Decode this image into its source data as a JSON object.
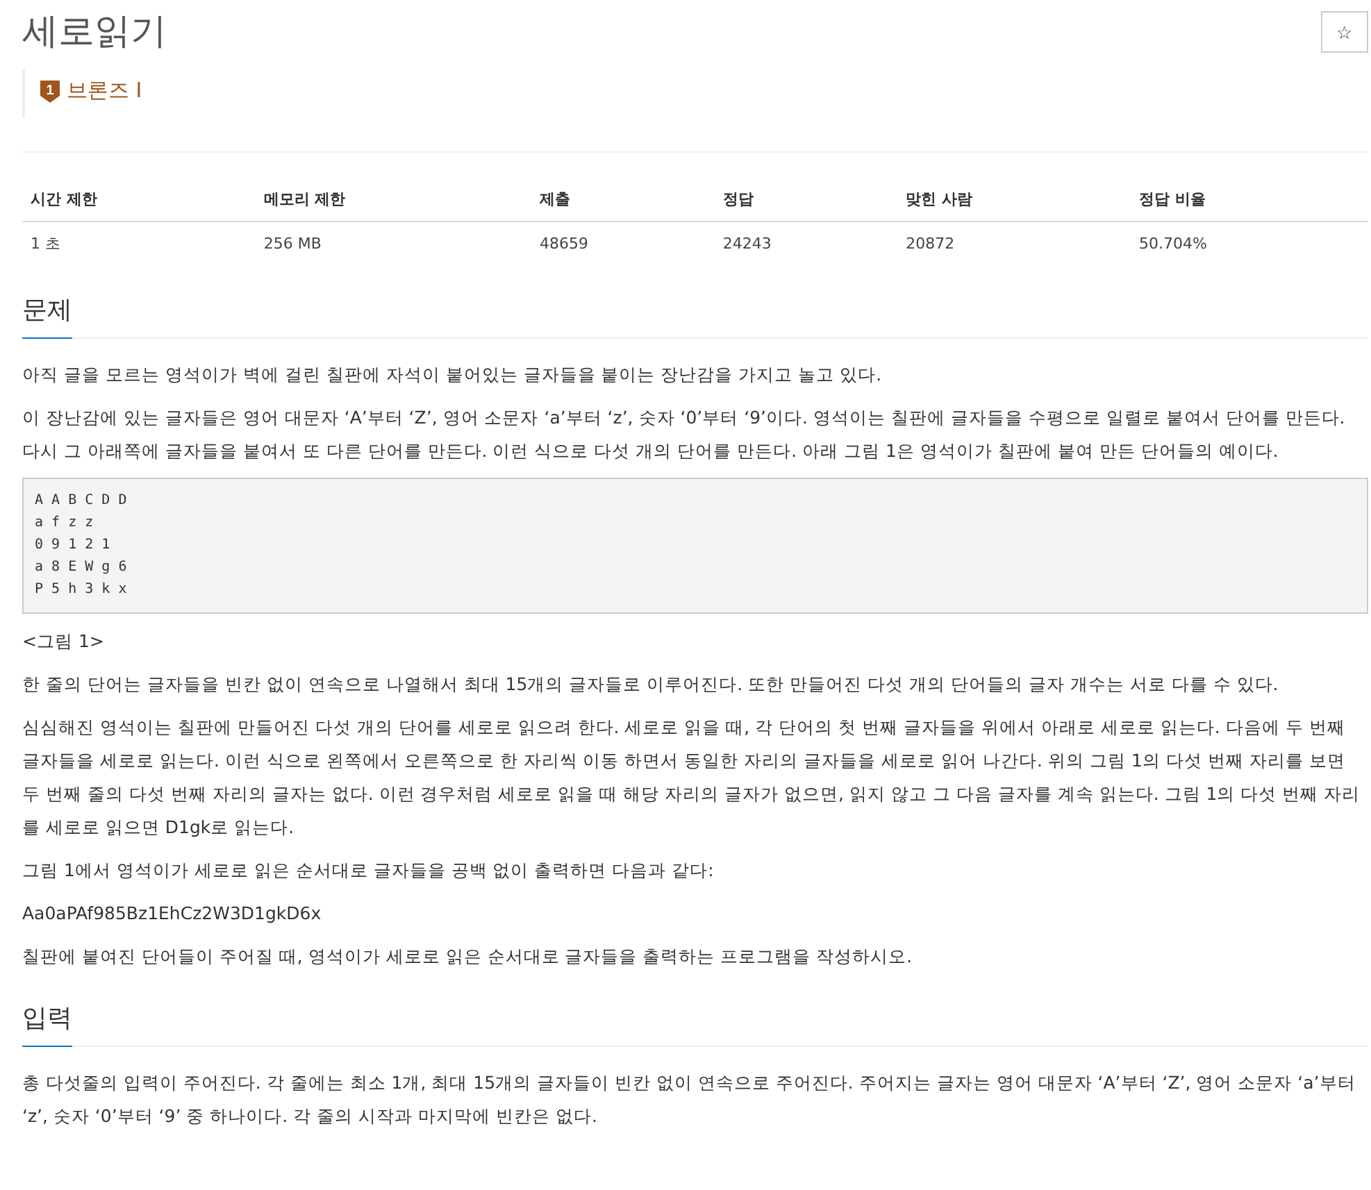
{
  "title": "세로읽기",
  "star_button": "☆",
  "tier": {
    "number": "1",
    "label": "브론즈 I"
  },
  "info_table": {
    "columns": [
      "시간 제한",
      "메모리 제한",
      "제출",
      "정답",
      "맞힌 사람",
      "정답 비율"
    ],
    "rows": [
      [
        "1 초",
        "256 MB",
        "48659",
        "24243",
        "20872",
        "50.704%"
      ]
    ]
  },
  "sections": [
    {
      "heading": "문제",
      "blocks": [
        {
          "kind": "text",
          "text": "아직 글을 모르는 영석이가 벽에 걸린 칠판에 자석이 붙어있는 글자들을 붙이는 장난감을 가지고 놀고 있다."
        },
        {
          "kind": "text",
          "text": "이 장난감에 있는 글자들은 영어 대문자 ‘A’부터 ‘Z’, 영어 소문자 ‘a’부터 ‘z’, 숫자 ‘0’부터 ‘9’이다. 영석이는 칠판에 글자들을 수평으로 일렬로 붙여서 단어를 만든다. 다시 그 아래쪽에 글자들을 붙여서 또 다른 단어를 만든다. 이런 식으로 다섯 개의 단어를 만든다. 아래 그림 1은 영석이가 칠판에 붙여 만든 단어들의 예이다."
        },
        {
          "kind": "code",
          "lines": [
            "A A B C D D",
            "a f z z",
            "0 9 1 2 1",
            "a 8 E W g 6",
            "P 5 h 3 k x"
          ]
        },
        {
          "kind": "text",
          "text": "<그림 1>"
        },
        {
          "kind": "text",
          "text": "한 줄의 단어는 글자들을 빈칸 없이 연속으로 나열해서 최대 15개의 글자들로 이루어진다. 또한 만들어진 다섯 개의 단어들의 글자 개수는 서로 다를 수 있다."
        },
        {
          "kind": "text",
          "text": "심심해진 영석이는 칠판에 만들어진 다섯 개의 단어를 세로로 읽으려 한다. 세로로 읽을 때, 각 단어의 첫 번째 글자들을 위에서 아래로 세로로 읽는다. 다음에 두 번째 글자들을 세로로 읽는다. 이런 식으로 왼쪽에서 오른쪽으로 한 자리씩 이동 하면서 동일한 자리의 글자들을 세로로 읽어 나간다. 위의 그림 1의 다섯 번째 자리를 보면 두 번째 줄의 다섯 번째 자리의 글자는 없다. 이런 경우처럼 세로로 읽을 때 해당 자리의 글자가 없으면, 읽지 않고 그 다음 글자를 계속 읽는다. 그림 1의 다섯 번째 자리를 세로로 읽으면 D1gk로 읽는다."
        },
        {
          "kind": "text",
          "text": "그림 1에서 영석이가 세로로 읽은 순서대로 글자들을 공백 없이 출력하면 다음과 같다:"
        },
        {
          "kind": "text",
          "text": "Aa0aPAf985Bz1EhCz2W3D1gkD6x"
        },
        {
          "kind": "text",
          "text": "칠판에 붙여진 단어들이 주어질 때, 영석이가 세로로 읽은 순서대로 글자들을 출력하는 프로그램을 작성하시오."
        }
      ]
    },
    {
      "heading": "입력",
      "blocks": [
        {
          "kind": "text",
          "text": "총 다섯줄의 입력이 주어진다. 각 줄에는 최소 1개, 최대 15개의 글자들이 빈칸 없이 연속으로 주어진다. 주어지는 글자는 영어 대문자 ‘A’부터 ‘Z’, 영어 소문자 ‘a’부터 ‘z’, 숫자 ‘0’부터 ‘9’ 중 하나이다. 각 줄의 시작과 마지막에 빈칸은 없다."
        }
      ]
    }
  ]
}
